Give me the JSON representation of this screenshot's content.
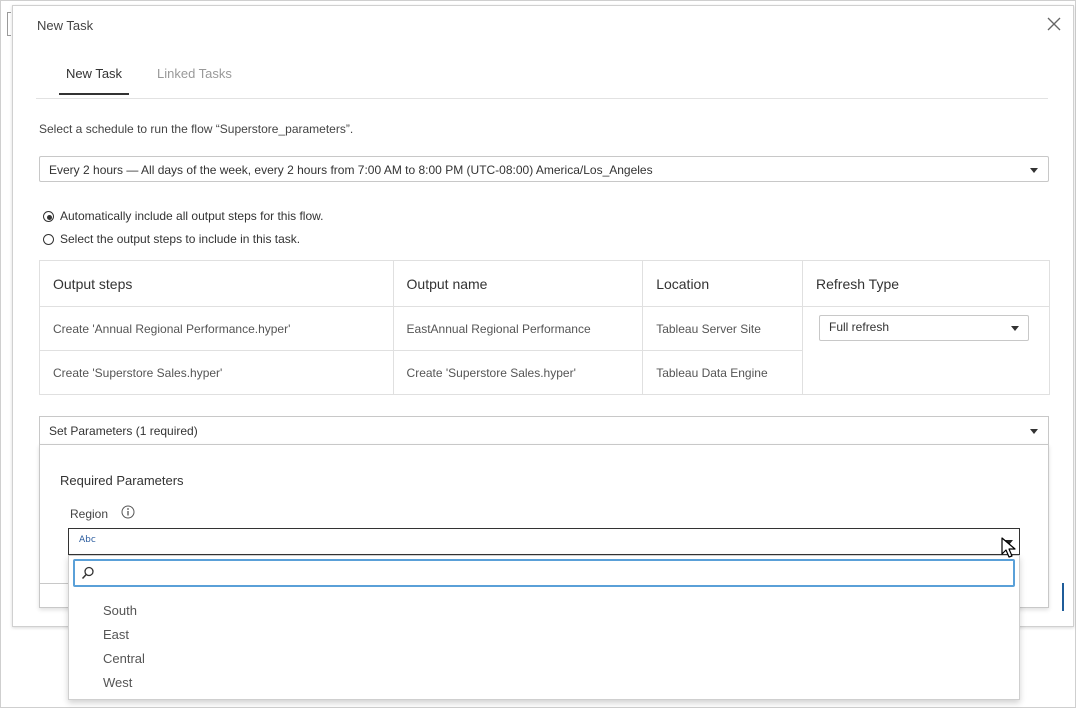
{
  "dialog": {
    "title": "New Task",
    "tabs": [
      {
        "label": "New Task",
        "active": true
      },
      {
        "label": "Linked Tasks",
        "active": false
      }
    ],
    "prompt": "Select a schedule to run the flow “Superstore_parameters”.",
    "schedule": {
      "selected": "Every 2 hours — All days of the week, every 2 hours from 7:00 AM to 8:00 PM (UTC-08:00) America/Los_Angeles"
    },
    "radios": [
      {
        "label": "Automatically include all output steps for this flow.",
        "checked": true
      },
      {
        "label": "Select the output steps to include in this task.",
        "checked": false
      }
    ],
    "table": {
      "headers": [
        "Output steps",
        "Output name",
        "Location",
        "Refresh Type"
      ],
      "rows": [
        [
          "Create 'Annual Regional Performance.hyper'",
          "EastAnnual Regional Performance",
          "Tableau Server Site"
        ],
        [
          "Create 'Superstore Sales.hyper'",
          "Create 'Superstore Sales.hyper'",
          "Tableau Data Engine"
        ]
      ],
      "refresh_type": "Full refresh"
    },
    "parameters": {
      "header": "Set Parameters (1 required)",
      "required_title": "Required Parameters",
      "region_label": "Region",
      "region_type_badge": "Abc",
      "search_value": "",
      "options": [
        "South",
        "East",
        "Central",
        "West"
      ]
    }
  },
  "colors": {
    "search_focus": "#5aa0d8",
    "primary_blue": "#1f5c99",
    "type_badge": "#2b5c9e"
  }
}
